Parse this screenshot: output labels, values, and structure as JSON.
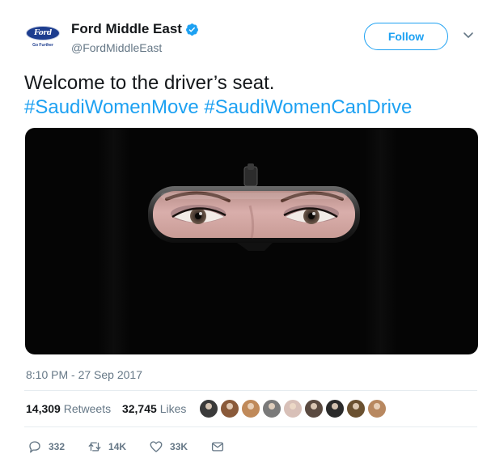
{
  "header": {
    "display_name": "Ford Middle East",
    "handle": "@FordMiddleEast",
    "avatar": {
      "logo_text": "Ford",
      "tagline": "Go Further"
    },
    "verified_icon": "verified-badge-icon",
    "follow_label": "Follow",
    "menu_icon": "chevron-down-icon"
  },
  "tweet": {
    "text_line1": "Welcome to the driver’s seat.",
    "hashtag1": "#SaudiWomenMove",
    "hashtag2": "#SaudiWomenCanDrive",
    "image_description_icon": "rearview-mirror-eyes-image",
    "timestamp": "8:10 PM - 27 Sep 2017"
  },
  "stats": {
    "retweets_count": "14,309",
    "retweets_label": "Retweets",
    "likes_count": "32,745",
    "likes_label": "Likes",
    "liker_avatars": [
      "#3a3a3a",
      "#8a5a3a",
      "#c08a5a",
      "#7a7a7a",
      "#d8c0b8",
      "#5a4a40",
      "#2a2a2a",
      "#6a5030",
      "#b88860"
    ]
  },
  "actions": {
    "reply_count": "332",
    "retweet_count": "14K",
    "like_count": "33K",
    "reply_icon": "reply-icon",
    "retweet_icon": "retweet-icon",
    "like_icon": "heart-icon",
    "dm_icon": "envelope-icon"
  },
  "colors": {
    "accent": "#1da1f2",
    "text": "#14171a",
    "secondary": "#657786",
    "divider": "#e6ecf0"
  }
}
